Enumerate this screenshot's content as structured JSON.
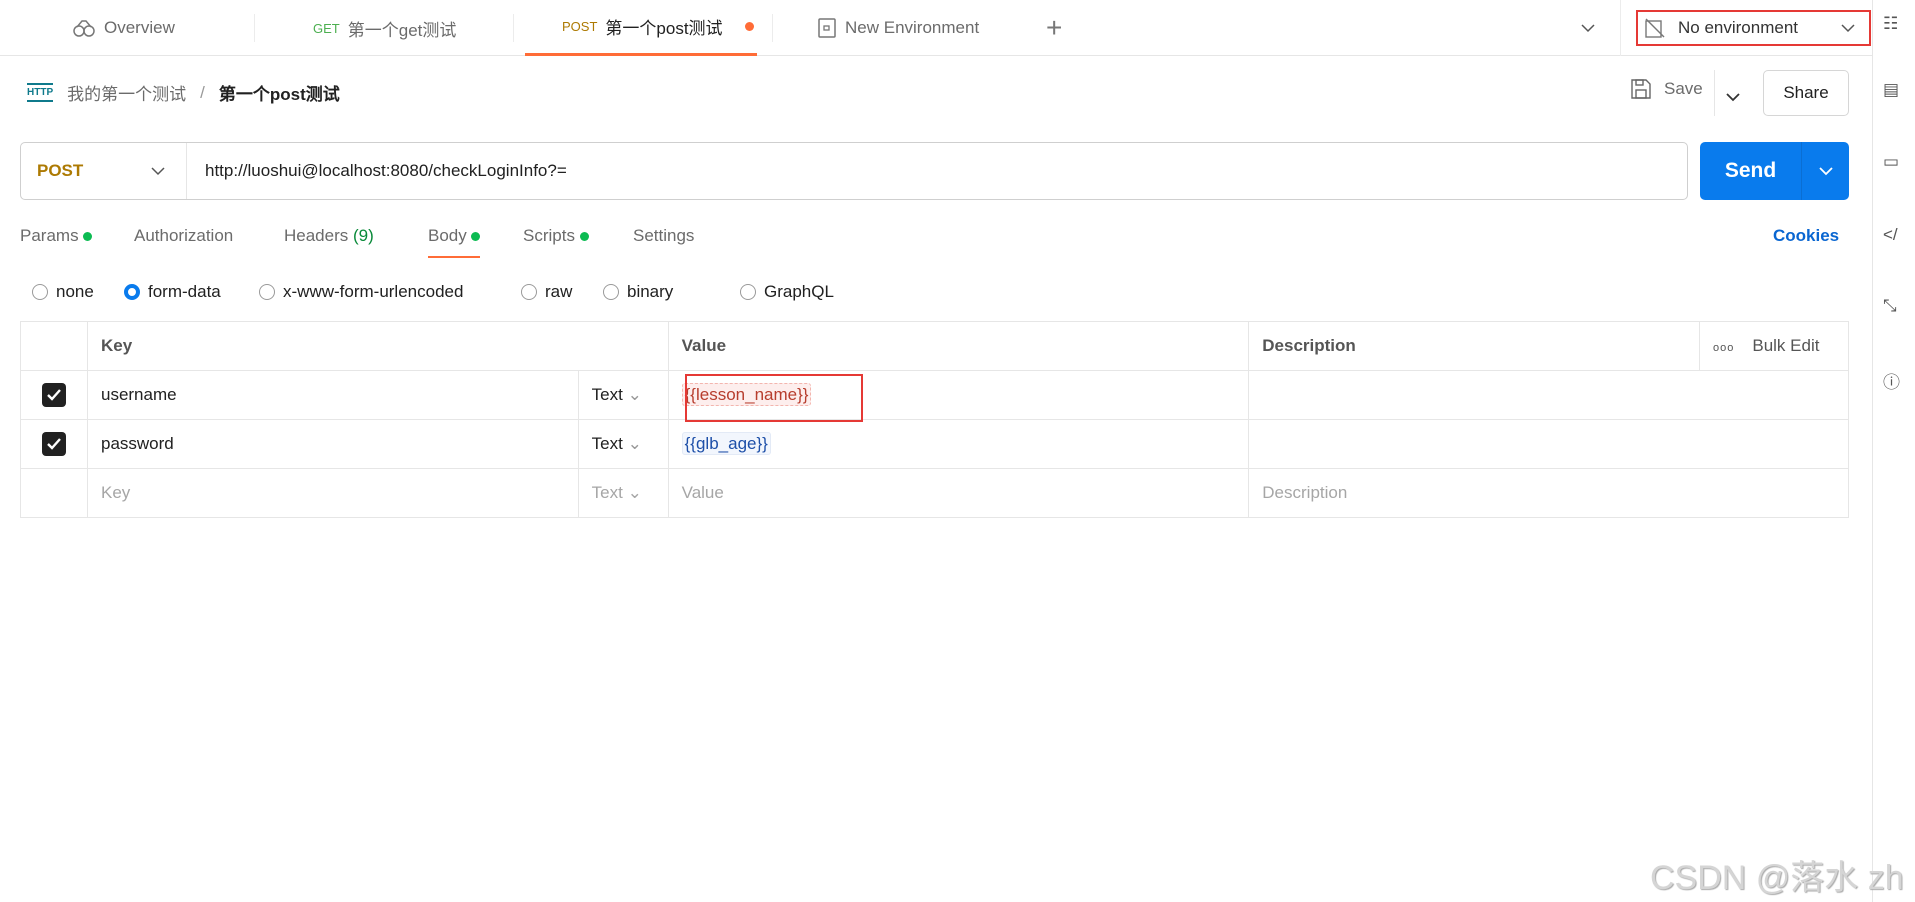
{
  "tabs": [
    {
      "label": "Overview",
      "icon": "overview-icon"
    },
    {
      "method": "GET",
      "label": "第一个get测试"
    },
    {
      "method": "POST",
      "label": "第一个post测试",
      "unsaved": true,
      "active": true
    },
    {
      "label": "New Environment",
      "icon": "environment-icon"
    }
  ],
  "environment": {
    "label": "No environment"
  },
  "breadcrumb": {
    "collection": "我的第一个测试",
    "separator": "/",
    "request": "第一个post测试"
  },
  "actions": {
    "save": "Save",
    "share": "Share"
  },
  "request": {
    "method": "POST",
    "url": "http://luoshui@localhost:8080/checkLoginInfo?=",
    "send": "Send"
  },
  "req_tabs": [
    {
      "label": "Params",
      "dot": true
    },
    {
      "label": "Authorization"
    },
    {
      "label": "Headers",
      "count": "(9)"
    },
    {
      "label": "Body",
      "dot": true,
      "active": true
    },
    {
      "label": "Scripts",
      "dot": true
    },
    {
      "label": "Settings"
    }
  ],
  "cookies": "Cookies",
  "body_types": [
    "none",
    "form-data",
    "x-www-form-urlencoded",
    "raw",
    "binary",
    "GraphQL"
  ],
  "body_selected": "form-data",
  "table": {
    "headers": {
      "key": "Key",
      "value": "Value",
      "description": "Description",
      "bulk": "Bulk Edit"
    },
    "rows": [
      {
        "checked": true,
        "key": "username",
        "type": "Text",
        "value": "{{lesson_name}}",
        "resolved": false
      },
      {
        "checked": true,
        "key": "password",
        "type": "Text",
        "value": "{{glb_age}}",
        "resolved": true
      }
    ],
    "placeholder": {
      "key": "Key",
      "type": "Text",
      "value": "Value",
      "description": "Description"
    }
  },
  "watermark": "CSDN @落水 zh",
  "colors": {
    "accent": "#097bed",
    "active_tab": "#ff6c37",
    "dot": "#0cbb52",
    "post": "#ad7a03",
    "highlight": "#e53935"
  }
}
